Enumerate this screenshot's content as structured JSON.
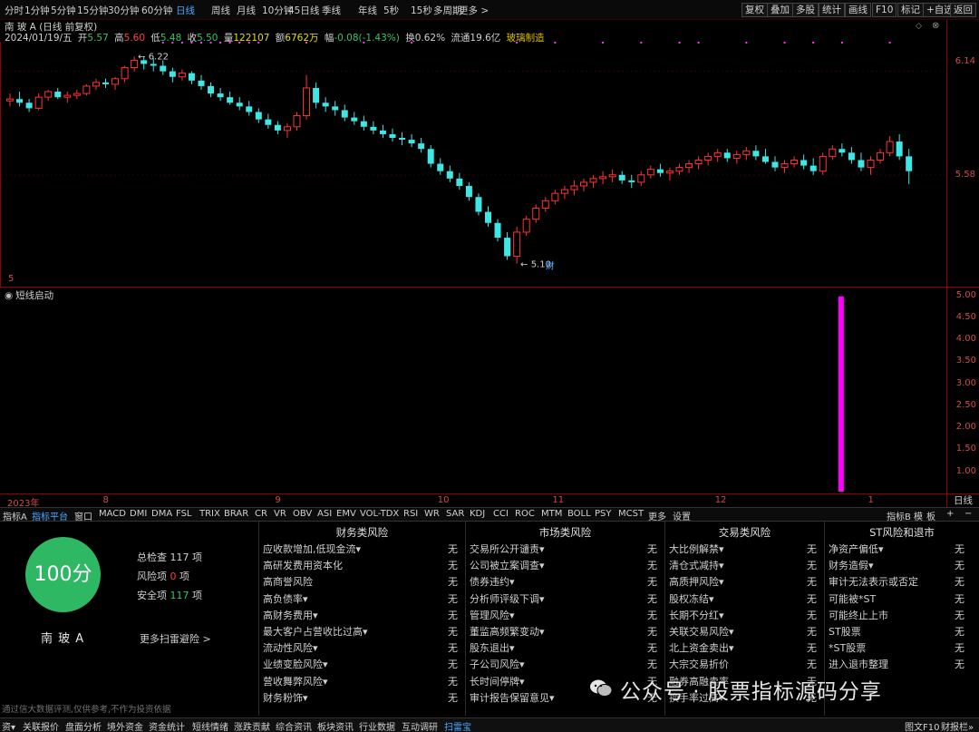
{
  "toolbar": {
    "periods": [
      "分时",
      "1分钟",
      "5分钟",
      "15分钟",
      "30分钟",
      "60分钟",
      "日线",
      "周线",
      "月线",
      "10分钟",
      "45日线",
      "季线",
      "年线",
      "5秒",
      "15秒",
      "多周期",
      "更多 >"
    ],
    "active_period": "日线",
    "tools": [
      "复权",
      "叠加",
      "多股",
      "统计",
      "画线",
      "F10",
      "标记",
      "+自选",
      "返回"
    ]
  },
  "quote": {
    "title": "南 玻 A (日线 前复权)",
    "date": "2024/01/19/五",
    "open_label": "开",
    "open": "5.57",
    "high_label": "高",
    "high": "5.60",
    "low_label": "低",
    "low": "5.48",
    "close_label": "收",
    "close": "5.50",
    "volume_label": "量",
    "volume": "122107",
    "amount_label": "额",
    "amount": "6762万",
    "change_label": "幅",
    "change": "-0.08(-1.43%)",
    "turnover_label": "换",
    "turnover": "0.62%",
    "float_label": "流通",
    "float": "19.6亿",
    "industry": "玻璃制造"
  },
  "price_axis": [
    "6.14",
    "5.58",
    "5"
  ],
  "chart_marks": {
    "high_note": "6.22",
    "low_note": "5.10",
    "fin_note": "财"
  },
  "sub_chart": {
    "title": "短线启动",
    "ticks": [
      "5.00",
      "4.50",
      "4.00",
      "3.50",
      "3.00",
      "2.50",
      "2.00",
      "1.50",
      "1.00"
    ],
    "bar_color": "#ff00ff"
  },
  "chart_data": [
    {
      "type": "candlestick",
      "title": "南 玻 A (日线 前复权)",
      "y_ticks": [
        6.14,
        5.58
      ],
      "ylim": [
        5.0,
        6.3
      ],
      "period_labels": [
        "2023年",
        "8",
        "9",
        "10",
        "11",
        "12",
        "1"
      ],
      "annotations": [
        {
          "text": "6.22",
          "type": "high"
        },
        {
          "text": "5.10",
          "type": "low"
        }
      ],
      "ohlc": [
        [
          5.98,
          6.02,
          5.95,
          5.99
        ],
        [
          5.99,
          6.03,
          5.95,
          5.97
        ],
        [
          5.97,
          5.99,
          5.92,
          5.94
        ],
        [
          5.94,
          6.02,
          5.93,
          6.0
        ],
        [
          6.0,
          6.04,
          5.98,
          6.03
        ],
        [
          6.03,
          6.05,
          5.99,
          6.0
        ],
        [
          6.0,
          6.03,
          5.97,
          6.01
        ],
        [
          6.01,
          6.04,
          5.99,
          6.02
        ],
        [
          6.02,
          6.07,
          6.01,
          6.06
        ],
        [
          6.06,
          6.1,
          6.04,
          6.08
        ],
        [
          6.08,
          6.1,
          6.05,
          6.07
        ],
        [
          6.07,
          6.11,
          6.04,
          6.1
        ],
        [
          6.1,
          6.17,
          6.08,
          6.16
        ],
        [
          6.16,
          6.22,
          6.14,
          6.2
        ],
        [
          6.2,
          6.22,
          6.15,
          6.18
        ],
        [
          6.18,
          6.21,
          6.14,
          6.17
        ],
        [
          6.17,
          6.2,
          6.12,
          6.14
        ],
        [
          6.14,
          6.16,
          6.08,
          6.11
        ],
        [
          6.11,
          6.15,
          6.09,
          6.13
        ],
        [
          6.13,
          6.14,
          6.07,
          6.09
        ],
        [
          6.09,
          6.12,
          6.04,
          6.06
        ],
        [
          6.06,
          6.08,
          6.0,
          6.02
        ],
        [
          6.02,
          6.05,
          5.98,
          6.0
        ],
        [
          6.0,
          6.03,
          5.96,
          5.97
        ],
        [
          5.97,
          6.0,
          5.93,
          5.95
        ],
        [
          5.95,
          5.98,
          5.9,
          5.92
        ],
        [
          5.92,
          5.94,
          5.86,
          5.88
        ],
        [
          5.88,
          5.91,
          5.83,
          5.85
        ],
        [
          5.85,
          5.87,
          5.8,
          5.82
        ],
        [
          5.82,
          5.86,
          5.78,
          5.84
        ],
        [
          5.84,
          5.92,
          5.82,
          5.9
        ],
        [
          5.9,
          6.12,
          5.88,
          6.05
        ],
        [
          6.05,
          6.08,
          5.94,
          5.97
        ],
        [
          5.97,
          6.0,
          5.92,
          5.95
        ],
        [
          5.95,
          5.98,
          5.9,
          5.93
        ],
        [
          5.93,
          5.96,
          5.87,
          5.89
        ],
        [
          5.89,
          5.92,
          5.85,
          5.87
        ],
        [
          5.87,
          5.9,
          5.82,
          5.84
        ],
        [
          5.84,
          5.87,
          5.8,
          5.82
        ],
        [
          5.82,
          5.85,
          5.78,
          5.8
        ],
        [
          5.8,
          5.83,
          5.76,
          5.78
        ],
        [
          5.78,
          5.81,
          5.74,
          5.77
        ],
        [
          5.77,
          5.8,
          5.73,
          5.75
        ],
        [
          5.75,
          5.78,
          5.7,
          5.72
        ],
        [
          5.72,
          5.74,
          5.62,
          5.64
        ],
        [
          5.64,
          5.67,
          5.58,
          5.6
        ],
        [
          5.6,
          5.63,
          5.54,
          5.56
        ],
        [
          5.56,
          5.59,
          5.5,
          5.52
        ],
        [
          5.52,
          5.54,
          5.44,
          5.46
        ],
        [
          5.46,
          5.48,
          5.36,
          5.38
        ],
        [
          5.38,
          5.41,
          5.3,
          5.32
        ],
        [
          5.32,
          5.34,
          5.22,
          5.24
        ],
        [
          5.24,
          5.27,
          5.12,
          5.14
        ],
        [
          5.14,
          5.3,
          5.1,
          5.27
        ],
        [
          5.27,
          5.36,
          5.25,
          5.34
        ],
        [
          5.34,
          5.42,
          5.32,
          5.4
        ],
        [
          5.4,
          5.46,
          5.38,
          5.44
        ],
        [
          5.44,
          5.5,
          5.42,
          5.48
        ],
        [
          5.48,
          5.52,
          5.45,
          5.5
        ],
        [
          5.5,
          5.55,
          5.47,
          5.52
        ],
        [
          5.52,
          5.56,
          5.49,
          5.54
        ],
        [
          5.54,
          5.58,
          5.51,
          5.56
        ],
        [
          5.56,
          5.6,
          5.53,
          5.57
        ],
        [
          5.57,
          5.61,
          5.54,
          5.58
        ],
        [
          5.58,
          5.6,
          5.53,
          5.55
        ],
        [
          5.55,
          5.58,
          5.51,
          5.54
        ],
        [
          5.54,
          5.6,
          5.52,
          5.58
        ],
        [
          5.58,
          5.63,
          5.56,
          5.61
        ],
        [
          5.61,
          5.64,
          5.57,
          5.59
        ],
        [
          5.59,
          5.62,
          5.55,
          5.6
        ],
        [
          5.6,
          5.64,
          5.58,
          5.62
        ],
        [
          5.62,
          5.66,
          5.59,
          5.64
        ],
        [
          5.64,
          5.68,
          5.61,
          5.66
        ],
        [
          5.66,
          5.7,
          5.63,
          5.68
        ],
        [
          5.68,
          5.72,
          5.65,
          5.7
        ],
        [
          5.7,
          5.72,
          5.65,
          5.67
        ],
        [
          5.67,
          5.71,
          5.64,
          5.69
        ],
        [
          5.69,
          5.73,
          5.66,
          5.71
        ],
        [
          5.71,
          5.74,
          5.66,
          5.68
        ],
        [
          5.68,
          5.72,
          5.64,
          5.65
        ],
        [
          5.65,
          5.68,
          5.6,
          5.62
        ],
        [
          5.62,
          5.66,
          5.59,
          5.64
        ],
        [
          5.64,
          5.68,
          5.62,
          5.66
        ],
        [
          5.66,
          5.69,
          5.61,
          5.63
        ],
        [
          5.63,
          5.67,
          5.58,
          5.6
        ],
        [
          5.6,
          5.7,
          5.58,
          5.68
        ],
        [
          5.68,
          5.74,
          5.66,
          5.72
        ],
        [
          5.72,
          5.75,
          5.68,
          5.7
        ],
        [
          5.7,
          5.73,
          5.64,
          5.66
        ],
        [
          5.66,
          5.7,
          5.6,
          5.62
        ],
        [
          5.62,
          5.68,
          5.58,
          5.66
        ],
        [
          5.66,
          5.72,
          5.64,
          5.7
        ],
        [
          5.7,
          5.79,
          5.68,
          5.76
        ],
        [
          5.76,
          5.8,
          5.66,
          5.68
        ],
        [
          5.68,
          5.72,
          5.53,
          5.6
        ]
      ]
    },
    {
      "type": "bar",
      "title": "短线启动",
      "ylim": [
        0.5,
        5.2
      ],
      "y_ticks": [
        5.0,
        4.5,
        4.0,
        3.5,
        3.0,
        2.5,
        2.0,
        1.5,
        1.0
      ],
      "bars": [
        {
          "position_index": 87,
          "value": 5.0
        }
      ]
    }
  ],
  "date_axis": [
    {
      "label": "2023年",
      "idx": 0
    },
    {
      "label": "8",
      "idx": 10
    },
    {
      "label": "9",
      "idx": 28
    },
    {
      "label": "10",
      "idx": 45
    },
    {
      "label": "11",
      "idx": 57
    },
    {
      "label": "12",
      "idx": 74
    },
    {
      "label": "1",
      "idx": 90
    }
  ],
  "day_line_label": "日线",
  "indicator_tabs": [
    "指标A",
    "指标平台",
    "窗口",
    "MACD",
    "DMI",
    "DMA",
    "FSL",
    "TRIX",
    "BRAR",
    "CR",
    "VR",
    "OBV",
    "ASI",
    "EMV",
    "VOL-TDX",
    "RSI",
    "WR",
    "SAR",
    "KDJ",
    "CCI",
    "ROC",
    "MTM",
    "BOLL",
    "PSY",
    "MCST",
    "更多",
    "设置"
  ],
  "indicator_right": [
    "指标B",
    "模",
    "板",
    "+",
    "−"
  ],
  "risk": {
    "score": "100分",
    "stock_name": "南 玻 A",
    "stats": [
      {
        "label": "总检查",
        "value": "117",
        "unit": "项",
        "color": "#d0d0d0"
      },
      {
        "label": "风险项",
        "value": "0",
        "unit": "项",
        "color": "#ff4040"
      },
      {
        "label": "安全项",
        "value": "117",
        "unit": "项",
        "color": "#35c46a"
      }
    ],
    "more": "更多扫雷避险 >",
    "columns": [
      {
        "title": "财务类风险",
        "items": [
          {
            "name": "应收款增加,低现金流▾",
            "val": "无"
          },
          {
            "name": "高研发费用资本化",
            "val": "无"
          },
          {
            "name": "高商誉风险",
            "val": "无"
          },
          {
            "name": "高负债率▾",
            "val": "无"
          },
          {
            "name": "高财务费用▾",
            "val": "无"
          },
          {
            "name": "最大客户占营收比过高▾",
            "val": "无"
          },
          {
            "name": "流动性风险▾",
            "val": "无"
          },
          {
            "name": "业绩变脸风险▾",
            "val": "无"
          },
          {
            "name": "营收舞弊风险▾",
            "val": "无"
          },
          {
            "name": "财务粉饰▾",
            "val": "无"
          }
        ]
      },
      {
        "title": "市场类风险",
        "items": [
          {
            "name": "交易所公开谴责▾",
            "val": "无"
          },
          {
            "name": "公司被立案调查▾",
            "val": "无"
          },
          {
            "name": "债券违约▾",
            "val": "无"
          },
          {
            "name": "分析师评级下调▾",
            "val": "无"
          },
          {
            "name": "管理风险▾",
            "val": "无"
          },
          {
            "name": "董监高频繁变动▾",
            "val": "无"
          },
          {
            "name": "股东退出▾",
            "val": "无"
          },
          {
            "name": "子公司风险▾",
            "val": "无"
          },
          {
            "name": "长时间停牌▾",
            "val": "无"
          },
          {
            "name": "审计报告保留意见▾",
            "val": "无"
          }
        ]
      },
      {
        "title": "交易类风险",
        "items": [
          {
            "name": "大比例解禁▾",
            "val": "无"
          },
          {
            "name": "清仓式减持▾",
            "val": "无"
          },
          {
            "name": "高质押风险▾",
            "val": "无"
          },
          {
            "name": "股权冻结▾",
            "val": "无"
          },
          {
            "name": "长期不分红▾",
            "val": "无"
          },
          {
            "name": "关联交易风险▾",
            "val": "无"
          },
          {
            "name": "北上资金卖出▾",
            "val": "无"
          },
          {
            "name": "大宗交易折价",
            "val": "无"
          },
          {
            "name": "融券高融卖率",
            "val": "无"
          },
          {
            "name": "换手率过高▾",
            "val": "无"
          }
        ]
      },
      {
        "title": "ST风险和退市",
        "items": [
          {
            "name": "净资产偏低▾",
            "val": "无"
          },
          {
            "name": "财务造假▾",
            "val": "无"
          },
          {
            "name": "审计无法表示或否定",
            "val": "无"
          },
          {
            "name": "可能被*ST",
            "val": "无"
          },
          {
            "name": "可能终止上市",
            "val": "无"
          },
          {
            "name": "ST股票",
            "val": "无"
          },
          {
            "name": "*ST股票",
            "val": "无"
          },
          {
            "name": "进入退市整理",
            "val": "无"
          }
        ]
      }
    ]
  },
  "footnote": "通过信大数据评测,仅供参考,不作为投资依据",
  "watermark": "公众号 · 股票指标源码分享",
  "bottom_tabs": [
    "资▾",
    "关联报价",
    "盘面分析",
    "境外资金",
    "资金统计",
    "短线情绪",
    "涨跌贡献",
    "综合资讯",
    "板块资讯",
    "行业数据",
    "互动调研",
    "扫雷宝"
  ],
  "bottom_active": "扫雷宝",
  "bottom_right": [
    "图文F10",
    "财报栏»"
  ],
  "colors": {
    "up": "#ff3333",
    "down": "#3ee6e6",
    "axis": "#d24b4b",
    "border": "#8b0000",
    "score_bg": "#2fb863"
  }
}
